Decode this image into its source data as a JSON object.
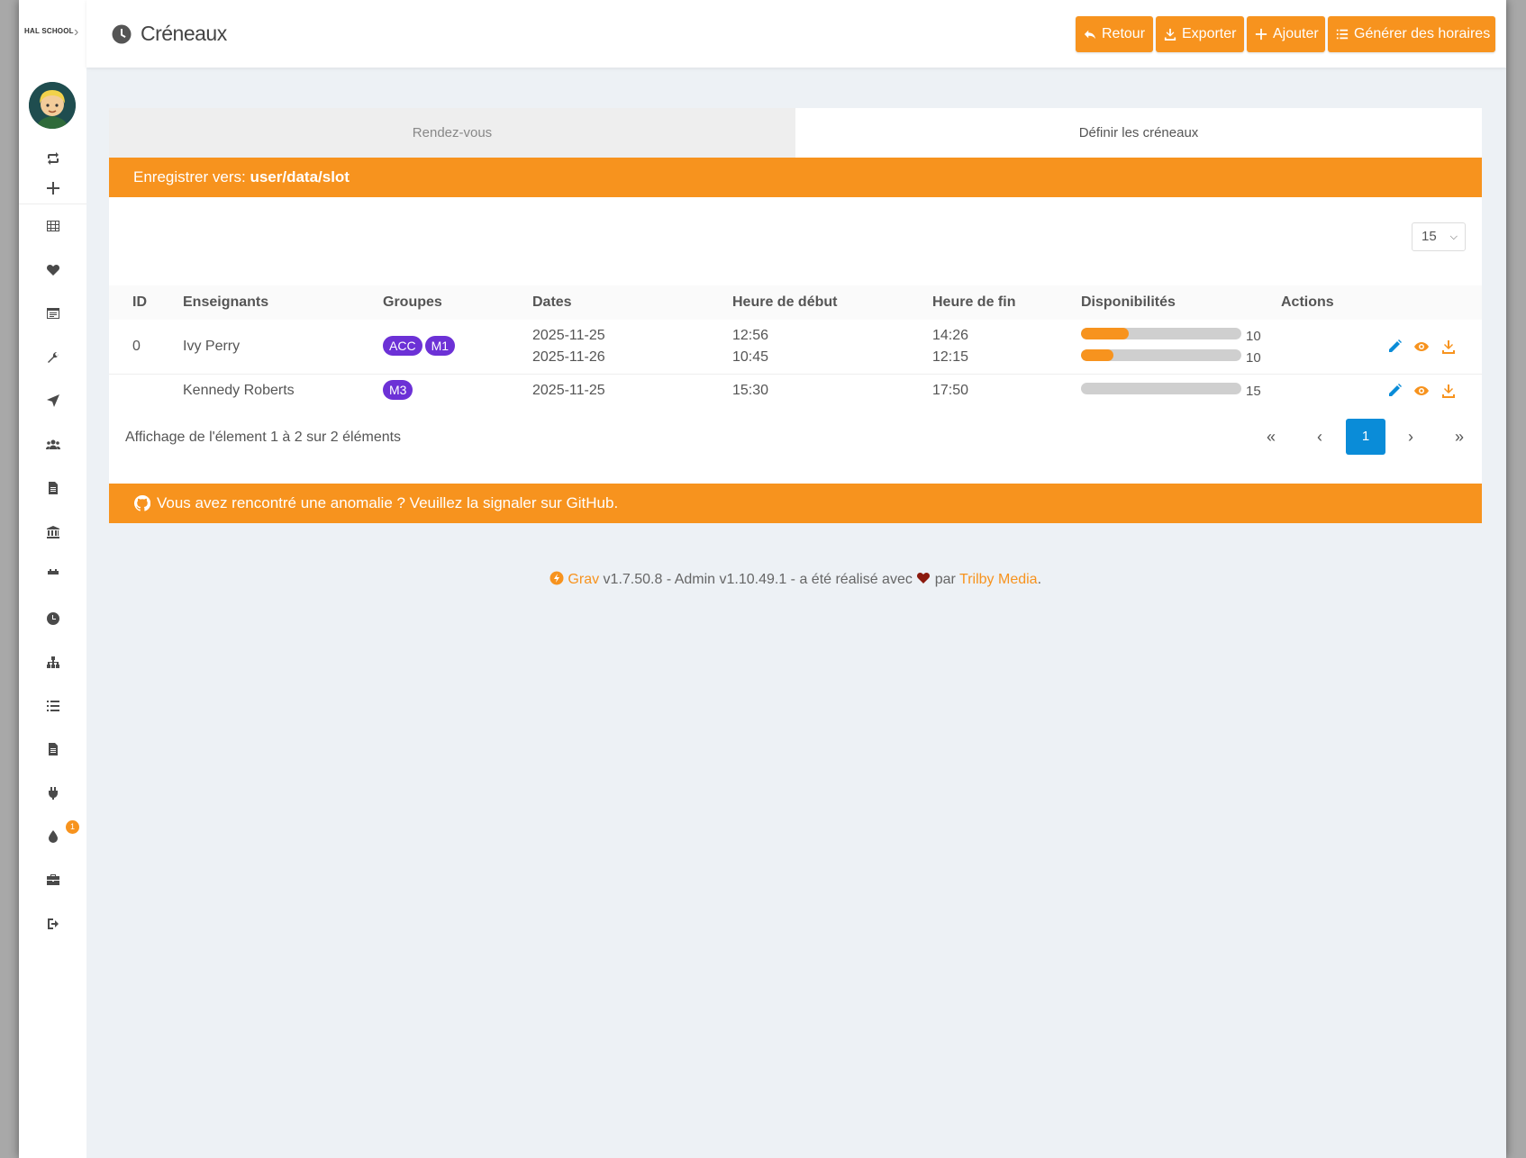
{
  "app": {
    "logo_text": "HAL SCHOOL",
    "page_title": "Créneaux"
  },
  "toolbar": {
    "back_label": "Retour",
    "export_label": "Exporter",
    "add_label": "Ajouter",
    "generate_label": "Générer des horaires"
  },
  "tabs": [
    {
      "label": "Rendez-vous",
      "active": false
    },
    {
      "label": "Définir les créneaux",
      "active": true
    }
  ],
  "save_bar": {
    "prefix": "Enregistrer vers: ",
    "path": "user/data/slot"
  },
  "per_page": {
    "value": "15"
  },
  "table": {
    "headers": [
      "ID",
      "Enseignants",
      "Groupes",
      "Dates",
      "Heure de début",
      "Heure de fin",
      "Disponibilités",
      "Actions"
    ],
    "rows": [
      {
        "id": "0",
        "teacher": "Ivy Perry",
        "groups": [
          "ACC",
          "M1"
        ],
        "dates": [
          "2025-11-25",
          "2025-11-26"
        ],
        "start": [
          "12:56",
          "10:45"
        ],
        "end": [
          "14:26",
          "12:15"
        ],
        "availability": [
          {
            "fraction": 0.3,
            "value": "10"
          },
          {
            "fraction": 0.2,
            "value": "10"
          }
        ]
      },
      {
        "id": "",
        "teacher": "Kennedy Roberts",
        "groups": [
          "M3"
        ],
        "dates": [
          "2025-11-25"
        ],
        "start": [
          "15:30"
        ],
        "end": [
          "17:50"
        ],
        "availability": [
          {
            "fraction": 0.0,
            "value": "15"
          }
        ]
      }
    ]
  },
  "pagination": {
    "info": "Affichage de l'élement 1 à 2 sur 2 éléments",
    "current": "1",
    "first": "«",
    "prev": "‹",
    "next": "›",
    "last": "»"
  },
  "bug_bar": {
    "text": "Vous avez rencontré une anomalie ? Veuillez la signaler sur GitHub."
  },
  "footer": {
    "grav": "Grav",
    "middle": " v1.7.50.8 - Admin v1.10.49.1 - a été réalisé avec ",
    "by": " par ",
    "trilby": "Trilby Media",
    "end": "."
  },
  "notifications": {
    "count": "1"
  },
  "colors": {
    "accent": "#f7931e",
    "badge": "#6c31d6",
    "pagination_active": "#0a8cd8",
    "edit_icon": "#0a8cd8"
  }
}
